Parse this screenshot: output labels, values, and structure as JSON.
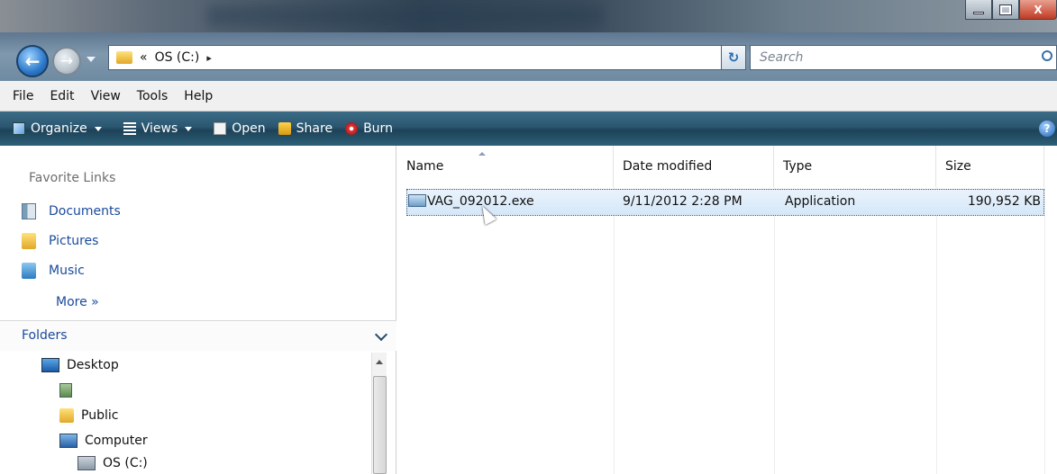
{
  "window": {
    "minimize_icon": "minimize-icon",
    "maximize_icon": "maximize-icon",
    "close_label": "X"
  },
  "address": {
    "overflow": "«",
    "crumb": "OS (C:)",
    "arrow": "▸"
  },
  "search": {
    "placeholder": "Search"
  },
  "menu": [
    "File",
    "Edit",
    "View",
    "Tools",
    "Help"
  ],
  "toolbar": {
    "organize": "Organize",
    "views": "Views",
    "open": "Open",
    "share": "Share",
    "burn": "Burn",
    "help": "?"
  },
  "favorites": {
    "title": "Favorite Links",
    "items": [
      "Documents",
      "Pictures",
      "Music"
    ],
    "more": "More »"
  },
  "folders": {
    "title": "Folders",
    "tree": [
      "Desktop",
      "Public",
      "Computer",
      "OS (C:)"
    ]
  },
  "columns": [
    "Name",
    "Date modified",
    "Type",
    "Size"
  ],
  "files": [
    {
      "name": "VAG_092012.exe",
      "date": "9/11/2012 2:28 PM",
      "type": "Application",
      "size": "190,952 KB"
    }
  ]
}
